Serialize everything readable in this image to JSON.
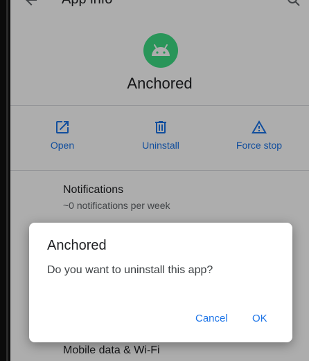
{
  "topbar": {
    "title": "App info"
  },
  "app": {
    "name": "Anchored"
  },
  "actions": [
    {
      "label": "Open",
      "icon": "open-in-new-icon"
    },
    {
      "label": "Uninstall",
      "icon": "trash-icon"
    },
    {
      "label": "Force stop",
      "icon": "warning-icon"
    }
  ],
  "prefs": [
    {
      "title": "Notifications",
      "subtitle": "~0 notifications per week"
    },
    {
      "title": "Mobile data & Wi-Fi"
    }
  ],
  "dialog": {
    "title": "Anchored",
    "message": "Do you want to uninstall this app?",
    "cancel": "Cancel",
    "ok": "OK"
  },
  "colors": {
    "accent": "#1a73e8",
    "android": "#3ddc84"
  }
}
